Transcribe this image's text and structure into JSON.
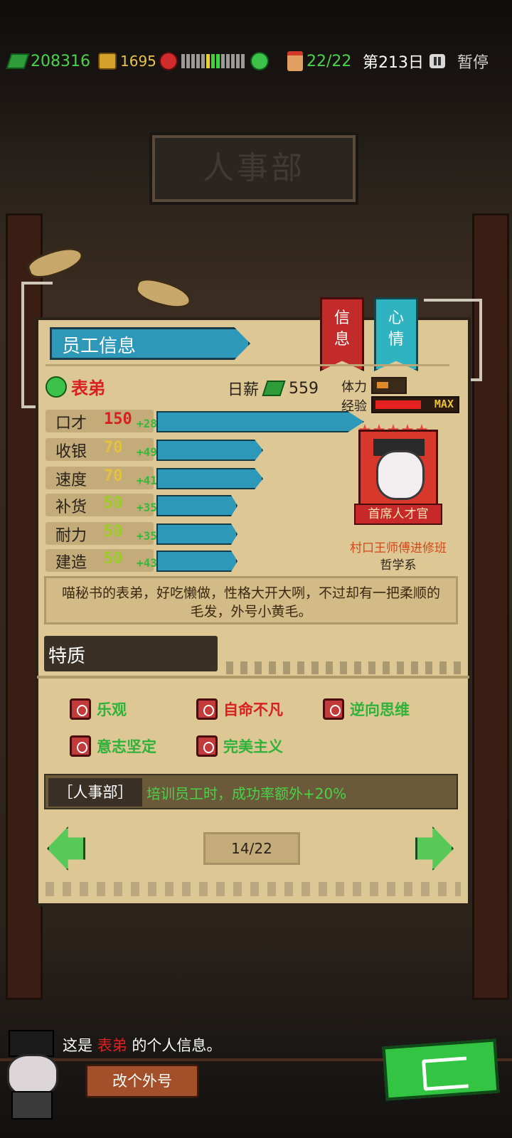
{
  "topbar": {
    "cash": "208316",
    "gold": "1695",
    "mood_level": 0.6,
    "staff": "22/22",
    "day": "第213日",
    "pause_label": "暂停"
  },
  "background": {
    "sign": "人事部"
  },
  "panel": {
    "header": "员工信息",
    "tabs": {
      "info": "信\n息",
      "mood": "心\n情"
    },
    "employee": {
      "name": "表弟",
      "salary_label": "日薪",
      "salary": "559",
      "stamina_label": "体力",
      "exp_label": "经验",
      "exp_badge": "MAX",
      "stamina_level": 0.4,
      "exp_level": 1.0
    },
    "stats": [
      {
        "name": "口才",
        "value": "150",
        "bonus": "+28",
        "color": "#d92020"
      },
      {
        "name": "收银",
        "value": "70",
        "bonus": "+49",
        "color": "#e2c23a"
      },
      {
        "name": "速度",
        "value": "70",
        "bonus": "+41",
        "color": "#e2c23a"
      },
      {
        "name": "补货",
        "value": "50",
        "bonus": "+35",
        "color": "#9ccc2a"
      },
      {
        "name": "耐力",
        "value": "50",
        "bonus": "+35",
        "color": "#9ccc2a"
      },
      {
        "name": "建造",
        "value": "50",
        "bonus": "+43",
        "color": "#9ccc2a"
      }
    ],
    "portrait": {
      "title": "首席人才官",
      "school_line1": "村口王师傅进修班",
      "school_line2": "哲学系",
      "stars": 5
    },
    "description": "喵秘书的表弟，好吃懒做，性格大开大咧，不过却有一把柔顺的毛发，外号小黄毛。",
    "traits_header": "特质",
    "traits": [
      {
        "label": "乐观",
        "color": "#2fb23a"
      },
      {
        "label": "自命不凡",
        "color": "#d82020"
      },
      {
        "label": "逆向思维",
        "color": "#2fb23a"
      },
      {
        "label": "意志坚定",
        "color": "#2fb23a"
      },
      {
        "label": "完美主义",
        "color": "#2fb23a"
      }
    ],
    "department": {
      "tag": "［人事部］",
      "effect": "培训员工时，成功率额外+20%"
    },
    "pager": "14/22"
  },
  "footer": {
    "msg_prefix": "这是",
    "msg_name": "表弟",
    "msg_suffix": "的个人信息。",
    "rename_label": "改个外号"
  }
}
